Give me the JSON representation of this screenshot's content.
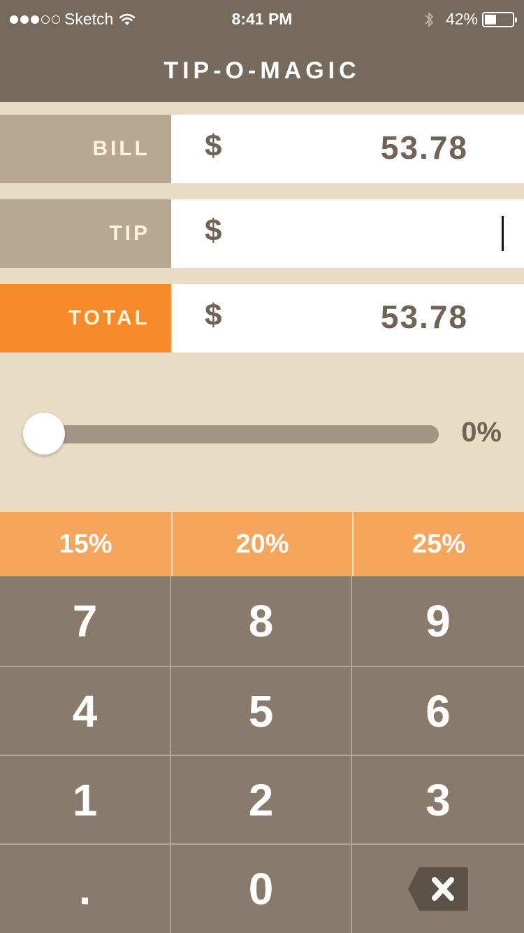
{
  "status_bar": {
    "carrier": "Sketch",
    "time": "8:41 PM",
    "battery": "42%",
    "battery_level": 0.42,
    "signal_bars_filled": 3,
    "signal_bars_total": 5
  },
  "app": {
    "title": "TIP-O-MAGIC"
  },
  "rows": {
    "bill": {
      "label": "BILL",
      "currency": "$",
      "value": "53.78"
    },
    "tip": {
      "label": "TIP",
      "currency": "$",
      "value": ""
    },
    "total": {
      "label": "TOTAL",
      "currency": "$",
      "value": "53.78"
    }
  },
  "slider": {
    "value_label": "0%",
    "value": 0
  },
  "presets": [
    "15%",
    "20%",
    "25%"
  ],
  "keypad": {
    "keys": [
      "7",
      "8",
      "9",
      "4",
      "5",
      "6",
      "1",
      "2",
      "3",
      ".",
      "0"
    ],
    "backspace_icon": "backspace-icon"
  },
  "colors": {
    "header": "#766a5c",
    "accent": "#f68a2b",
    "preset": "#f6a55d",
    "keypad": "#887b6b",
    "background": "#e8dcc4"
  }
}
